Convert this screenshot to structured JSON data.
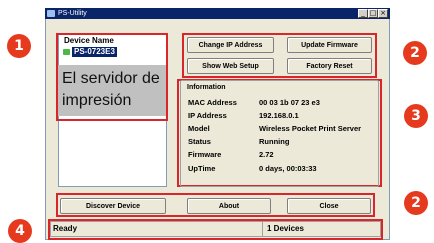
{
  "window": {
    "title": "PS-Utility",
    "minimize_glyph": "_",
    "maximize_glyph": "□",
    "close_glyph": "×"
  },
  "device_list": {
    "header": "Device Name",
    "items": [
      {
        "label": "PS-0723E3",
        "icon": "printer-server-icon",
        "selected": true
      }
    ]
  },
  "overlay": {
    "line1": "El servidor de",
    "line2": "impresión"
  },
  "buttons": {
    "change_ip": "Change IP Address",
    "update_firmware": "Update Firmware",
    "show_web_setup": "Show Web Setup",
    "factory_reset": "Factory Reset",
    "discover_device": "Discover Device",
    "about": "About",
    "close": "Close"
  },
  "information": {
    "title": "Information",
    "rows": [
      {
        "key": "MAC Address",
        "value": "00 03 1b 07 23 e3"
      },
      {
        "key": "IP Address",
        "value": "192.168.0.1"
      },
      {
        "key": "Model",
        "value": "Wireless Pocket Print Server"
      },
      {
        "key": "Status",
        "value": "Running"
      },
      {
        "key": "Firmware",
        "value": "2.72"
      },
      {
        "key": "UpTime",
        "value": "0 days, 00:03:33"
      }
    ]
  },
  "statusbar": {
    "left": "Ready",
    "right": "1 Devices"
  },
  "badges": [
    "1",
    "2",
    "3",
    "2",
    "4"
  ],
  "colors": {
    "highlight_red": "#d8262a",
    "badge_red": "#e63a1f",
    "selection_blue": "#0a246a"
  }
}
